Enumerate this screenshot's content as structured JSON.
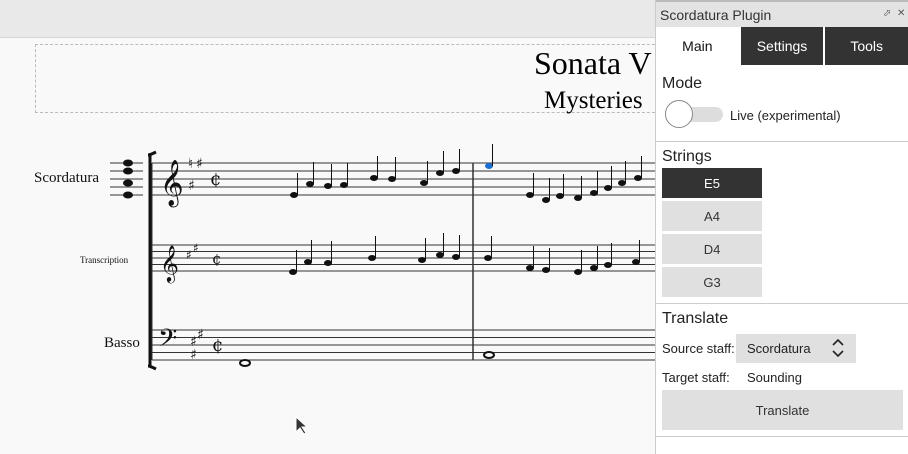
{
  "score": {
    "title": "Sonata V",
    "subtitle": "Mysteries",
    "staves": [
      "Scordatura",
      "Transcription",
      "Basso"
    ]
  },
  "panel": {
    "title": "Scordatura Plugin",
    "icons": {
      "float": "float-icon",
      "close": "close-icon"
    },
    "tabs": [
      {
        "label": "Main",
        "active": true
      },
      {
        "label": "Settings"
      },
      {
        "label": "Tools"
      }
    ],
    "mode": {
      "heading": "Mode",
      "toggle_label": "Live (experimental)",
      "toggle_on": false
    },
    "strings": {
      "heading": "Strings",
      "items": [
        "E5",
        "A4",
        "D4",
        "G3"
      ],
      "selected": "E5"
    },
    "translate": {
      "heading": "Translate",
      "source_label": "Source staff:",
      "source_value": "Scordatura",
      "target_label": "Target staff:",
      "target_value": "Sounding",
      "button": "Translate"
    }
  }
}
